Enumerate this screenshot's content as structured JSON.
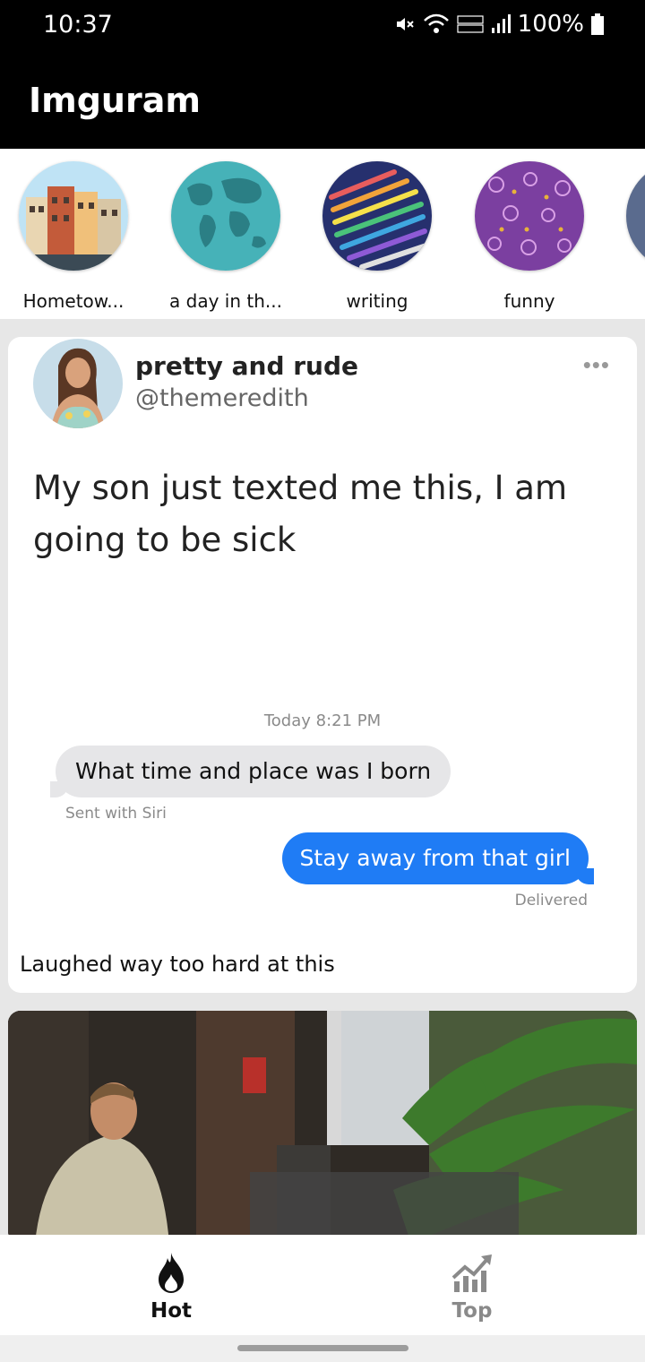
{
  "status_bar": {
    "time": "10:37",
    "battery": "100%",
    "icons": [
      "mute-icon",
      "wifi-icon",
      "volte-icon",
      "signal-icon",
      "battery-icon"
    ]
  },
  "app_bar": {
    "title": "Imguram"
  },
  "stories": [
    {
      "label": "Hometow...",
      "icon": "hometown-thumbnail"
    },
    {
      "label": "a day in th...",
      "icon": "world-map-thumbnail"
    },
    {
      "label": "writing",
      "icon": "pencils-thumbnail"
    },
    {
      "label": "funny",
      "icon": "purple-pattern-thumbnail"
    }
  ],
  "post1": {
    "author_name": "pretty and rude",
    "handle": "@themeredith",
    "tweet_text": "My son just texted me this, I am going to be sick",
    "message_date": "Today 8:21 PM",
    "incoming_message": "What time and place was I born",
    "incoming_note": "Sent with Siri",
    "outgoing_message": "Stay away from that girl",
    "outgoing_status": "Delivered",
    "caption": "Laughed way too hard at this",
    "colors": {
      "incoming_bubble": "#e6e6e8",
      "outgoing_bubble": "#1f7cf5"
    }
  },
  "bottom_nav": {
    "items": [
      {
        "label": "Hot",
        "icon": "flame-icon",
        "active": true
      },
      {
        "label": "Top",
        "icon": "trending-chart-icon",
        "active": false
      }
    ]
  }
}
